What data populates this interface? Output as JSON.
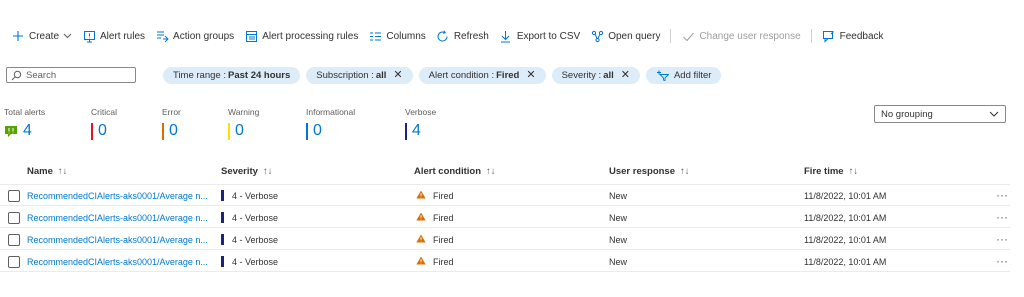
{
  "toolbar": {
    "create": "Create",
    "alert_rules": "Alert rules",
    "action_groups": "Action groups",
    "alert_processing_rules": "Alert processing rules",
    "columns": "Columns",
    "refresh": "Refresh",
    "export_csv": "Export to CSV",
    "open_query": "Open query",
    "change_user_response": "Change user response",
    "feedback": "Feedback"
  },
  "filters": {
    "search_placeholder": "Search",
    "time_range_label": "Time range :",
    "time_range_value": "Past 24 hours",
    "subscription_label": "Subscription :",
    "subscription_value": "all",
    "alert_condition_label": "Alert condition :",
    "alert_condition_value": "Fired",
    "severity_label": "Severity :",
    "severity_value": "all",
    "add_filter": "Add filter"
  },
  "summary": {
    "total": {
      "label": "Total alerts",
      "value": "4",
      "color": "#57a300"
    },
    "critical": {
      "label": "Critical",
      "value": "0",
      "color": "#e81123"
    },
    "error": {
      "label": "Error",
      "value": "0",
      "color": "#d86e00"
    },
    "warning": {
      "label": "Warning",
      "value": "0",
      "color": "#fce100"
    },
    "informational": {
      "label": "Informational",
      "value": "0",
      "color": "#0078d4"
    },
    "verbose": {
      "label": "Verbose",
      "value": "4",
      "color": "#1a237e"
    }
  },
  "grouping": {
    "value": "No grouping"
  },
  "table": {
    "headers": {
      "name": "Name",
      "severity": "Severity",
      "alert_condition": "Alert condition",
      "user_response": "User response",
      "fire_time": "Fire time"
    },
    "rows": [
      {
        "name": "RecommendedCIAlerts-aks0001/Average n...",
        "severity": "4 - Verbose",
        "condition": "Fired",
        "response": "New",
        "time": "11/8/2022, 10:01 AM"
      },
      {
        "name": "RecommendedCIAlerts-aks0001/Average n...",
        "severity": "4 - Verbose",
        "condition": "Fired",
        "response": "New",
        "time": "11/8/2022, 10:01 AM"
      },
      {
        "name": "RecommendedCIAlerts-aks0001/Average n...",
        "severity": "4 - Verbose",
        "condition": "Fired",
        "response": "New",
        "time": "11/8/2022, 10:01 AM"
      },
      {
        "name": "RecommendedCIAlerts-aks0001/Average n...",
        "severity": "4 - Verbose",
        "condition": "Fired",
        "response": "New",
        "time": "11/8/2022, 10:01 AM"
      }
    ]
  }
}
